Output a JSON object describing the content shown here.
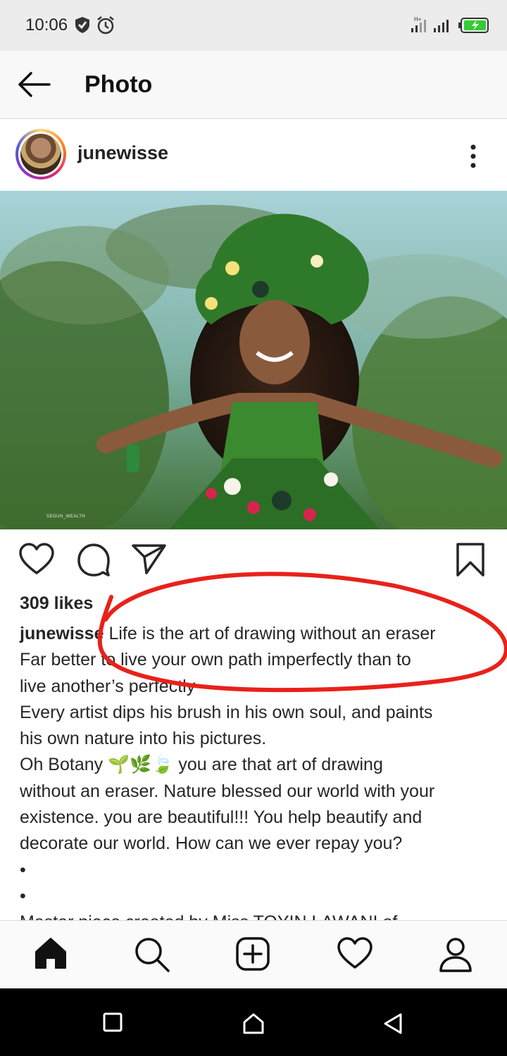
{
  "status_bar": {
    "time": "10:06",
    "icons": [
      "shield-check-icon",
      "alarm-icon",
      "signal-h-plus-icon",
      "signal-icon",
      "battery-charging-icon"
    ]
  },
  "app_bar": {
    "title": "Photo",
    "back_icon": "arrow-left-icon"
  },
  "post": {
    "username": "junewisse",
    "more_icon": "more-vertical-icon",
    "photo_watermark": "SEGUN_WEALTH",
    "likes": "309 likes",
    "caption_username": "junewisse",
    "caption_lines": [
      " Life is the art of drawing without an eraser",
      "Far better to live your own path imperfectly than to",
      "live another’s perfectly",
      "Every artist dips his brush in his own soul, and paints",
      "his own nature into his pictures.",
      "Oh Botany 🌱🌿🍃 you are that art of drawing",
      "without an eraser. Nature blessed our world with your",
      "existence. you are beautiful!!! You help beautify and",
      "decorate our world. How can we ever repay you?",
      "•",
      "•",
      "Master piece created by Miss TOYIN LAWANI of"
    ]
  },
  "actions": {
    "icons": [
      "heart-icon",
      "comment-icon",
      "share-icon",
      "bookmark-icon"
    ]
  },
  "bottom_nav": {
    "items": [
      "home-icon",
      "search-icon",
      "add-post-icon",
      "activity-heart-icon",
      "profile-icon"
    ]
  },
  "system_nav": {
    "items": [
      "recents-square-icon",
      "home-house-icon",
      "back-triangle-icon"
    ]
  },
  "colors": {
    "scribble": "#e8211a",
    "status_bar_bg": "#ececec",
    "app_bar_bg": "#f8f8f8",
    "battery_fill": "#33cc33"
  }
}
